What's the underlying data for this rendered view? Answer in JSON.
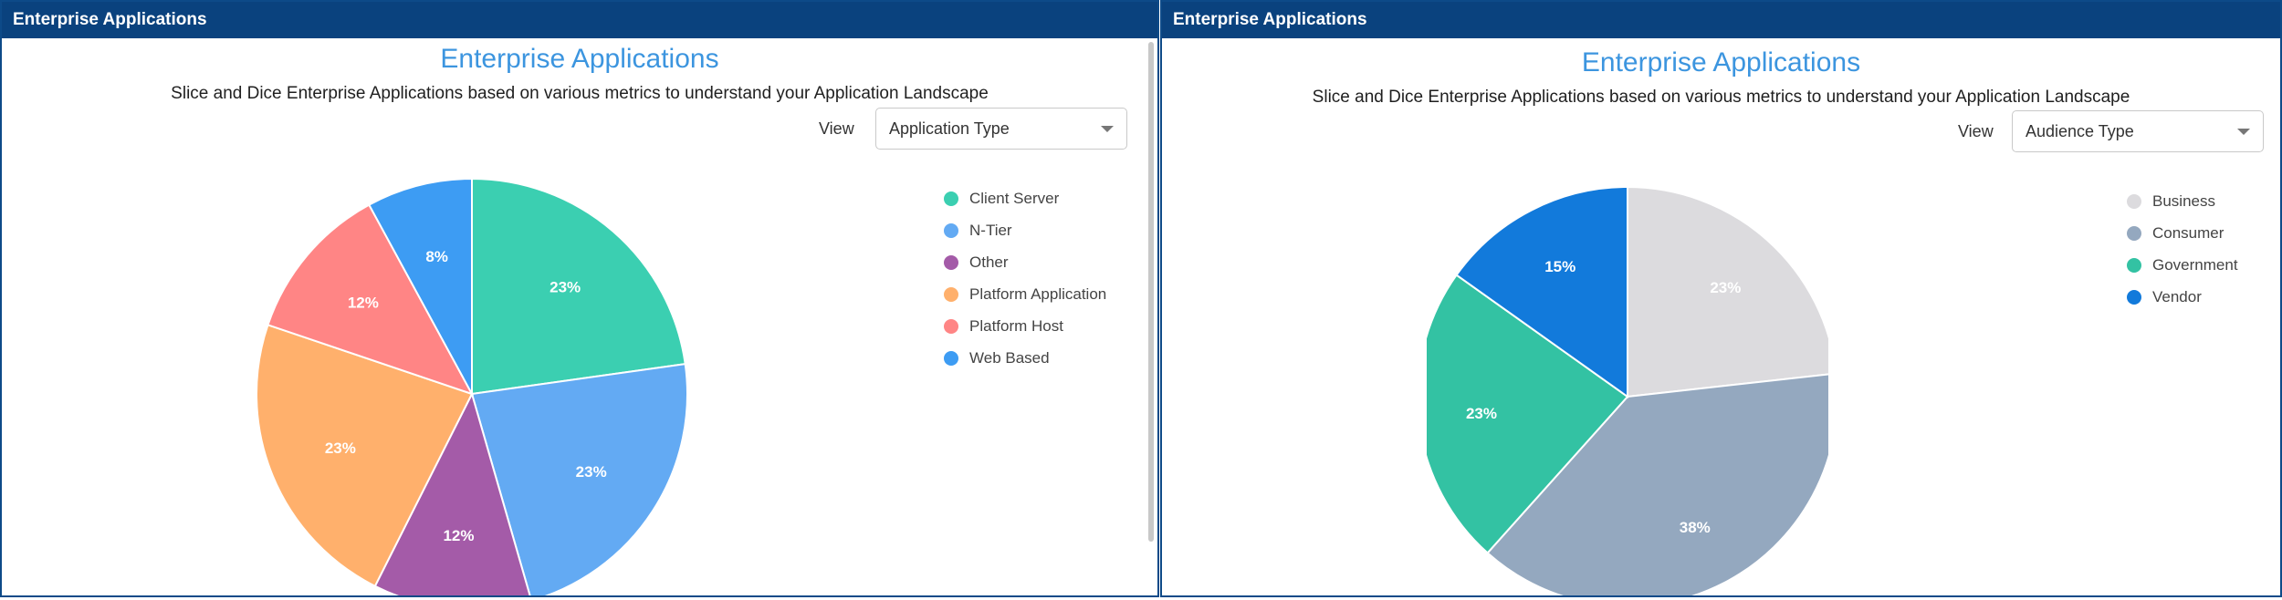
{
  "panels": [
    {
      "header": "Enterprise Applications",
      "title": "Enterprise Applications",
      "subtitle": "Slice and Dice Enterprise Applications based on various metrics to understand your Application Landscape",
      "view_label": "View",
      "view_value": "Application Type"
    },
    {
      "header": "Enterprise Applications",
      "title": "Enterprise Applications",
      "subtitle": "Slice and Dice Enterprise Applications based on various metrics to understand your Application Landscape",
      "view_label": "View",
      "view_value": "Audience Type"
    }
  ],
  "chart_data": [
    {
      "type": "pie",
      "title": "Enterprise Applications",
      "legend_position": "right",
      "slices": [
        {
          "label": "Client Server",
          "value": 23,
          "display": "23%",
          "color": "#3bcfb1"
        },
        {
          "label": "N-Tier",
          "value": 23,
          "display": "23%",
          "color": "#63aaf3"
        },
        {
          "label": "Other",
          "value": 12,
          "display": "12%",
          "color": "#a45ba8"
        },
        {
          "label": "Platform Application",
          "value": 23,
          "display": "23%",
          "color": "#ffb06c"
        },
        {
          "label": "Platform Host",
          "value": 12,
          "display": "12%",
          "color": "#ff8585"
        },
        {
          "label": "Web Based",
          "value": 8,
          "display": "8%",
          "color": "#3d9cf3"
        }
      ]
    },
    {
      "type": "pie",
      "title": "Enterprise Applications",
      "legend_position": "right",
      "slices": [
        {
          "label": "Business",
          "value": 23,
          "display": "23%",
          "color": "#dcdbde"
        },
        {
          "label": "Consumer",
          "value": 38,
          "display": "38%",
          "color": "#94a8bf"
        },
        {
          "label": "Government",
          "value": 23,
          "display": "23%",
          "color": "#33c2a3"
        },
        {
          "label": "Vendor",
          "value": 15,
          "display": "15%",
          "color": "#127adb"
        }
      ]
    }
  ]
}
